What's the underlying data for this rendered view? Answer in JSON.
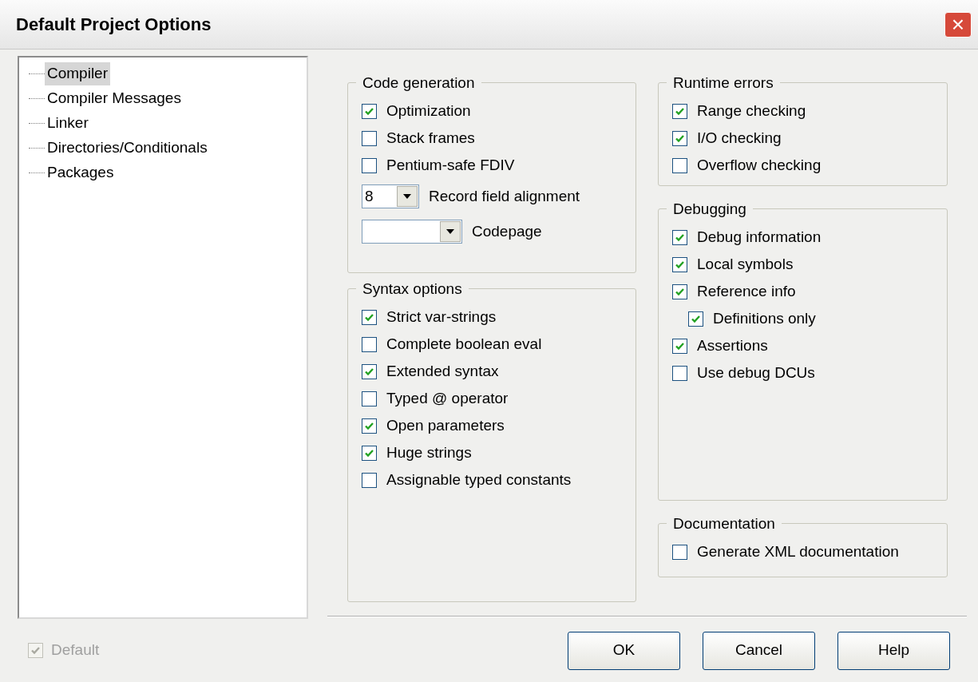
{
  "window": {
    "title": "Default Project Options",
    "close": "×"
  },
  "tree": {
    "items": [
      {
        "label": "Compiler",
        "selected": true
      },
      {
        "label": "Compiler Messages",
        "selected": false
      },
      {
        "label": "Linker",
        "selected": false
      },
      {
        "label": "Directories/Conditionals",
        "selected": false
      },
      {
        "label": "Packages",
        "selected": false
      }
    ]
  },
  "columns": [
    [
      {
        "title": "Code generation",
        "items": [
          {
            "kind": "checkbox",
            "label": "Optimization",
            "checked": true
          },
          {
            "kind": "checkbox",
            "label": "Stack frames",
            "checked": false
          },
          {
            "kind": "checkbox",
            "label": "Pentium-safe FDIV",
            "checked": false
          },
          {
            "kind": "combo",
            "field_text": "8",
            "label": "Record field alignment"
          },
          {
            "kind": "combo",
            "label": "Codepage"
          }
        ]
      },
      {
        "title": "Syntax options",
        "items": [
          {
            "kind": "checkbox",
            "label": "Strict var-strings",
            "checked": true
          },
          {
            "kind": "checkbox",
            "label": "Complete boolean eval",
            "checked": false
          },
          {
            "kind": "checkbox",
            "label": "Extended syntax",
            "checked": true
          },
          {
            "kind": "checkbox",
            "label": "Typed @ operator",
            "checked": false
          },
          {
            "kind": "checkbox",
            "label": "Open parameters",
            "checked": true
          },
          {
            "kind": "checkbox",
            "label": "Huge strings",
            "checked": true
          },
          {
            "kind": "checkbox",
            "label": "Assignable typed constants",
            "checked": false
          }
        ]
      }
    ],
    [
      {
        "title": "Runtime errors",
        "items": [
          {
            "kind": "checkbox",
            "label": "Range checking",
            "checked": true
          },
          {
            "kind": "checkbox",
            "label": "I/O checking",
            "checked": true
          },
          {
            "kind": "checkbox",
            "label": "Overflow checking",
            "checked": false
          }
        ]
      },
      {
        "title": "Debugging",
        "items": [
          {
            "kind": "checkbox",
            "label": "Debug information",
            "checked": true
          },
          {
            "kind": "checkbox",
            "label": "Local symbols",
            "checked": true
          },
          {
            "kind": "checkbox",
            "label": "Reference info",
            "checked": true,
            "children": [
              {
                "kind": "checkbox",
                "label": "Definitions only",
                "checked": true
              }
            ]
          },
          {
            "kind": "checkbox",
            "label": "Assertions",
            "checked": true
          },
          {
            "kind": "checkbox",
            "label": "Use debug DCUs",
            "checked": false
          }
        ]
      },
      {
        "title": "Documentation",
        "items": [
          {
            "kind": "checkbox",
            "label": "Generate XML documentation",
            "checked": false
          }
        ]
      }
    ]
  ],
  "default": {
    "label": "Default",
    "checked": true,
    "disabled": true
  },
  "buttons": [
    "OK",
    "Cancel",
    "Help"
  ]
}
